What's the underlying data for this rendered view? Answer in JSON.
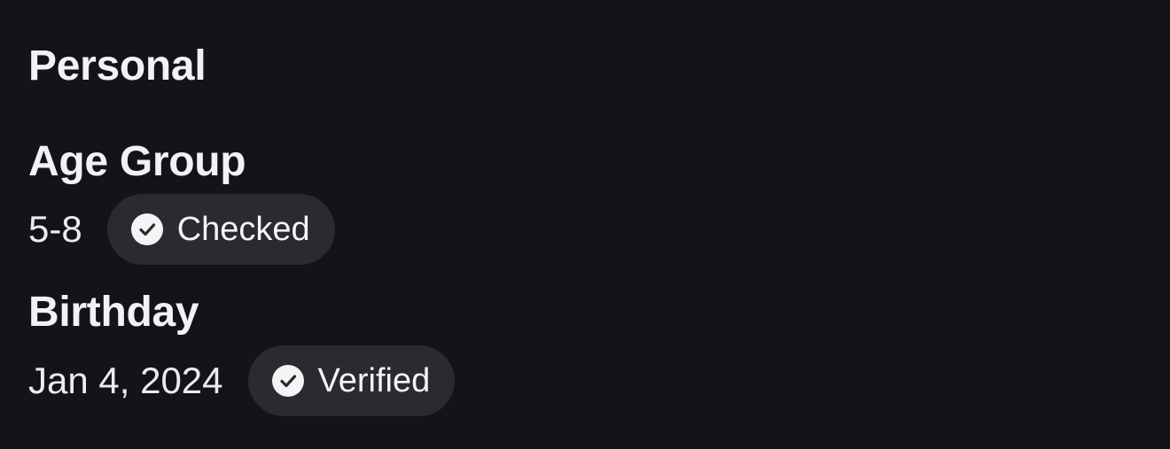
{
  "section": {
    "title": "Personal"
  },
  "fields": {
    "age_group": {
      "label": "Age Group",
      "value": "5-8",
      "badge_label": "Checked",
      "badge_icon": "check-circle-icon"
    },
    "birthday": {
      "label": "Birthday",
      "value": "Jan 4, 2024",
      "badge_label": "Verified",
      "badge_icon": "check-circle-icon"
    }
  },
  "colors": {
    "background": "#141318",
    "badge_background": "#2a2a2f",
    "text": "#f2f2f4",
    "icon_circle": "#f4f4f6",
    "icon_check": "#2a2a2f"
  }
}
